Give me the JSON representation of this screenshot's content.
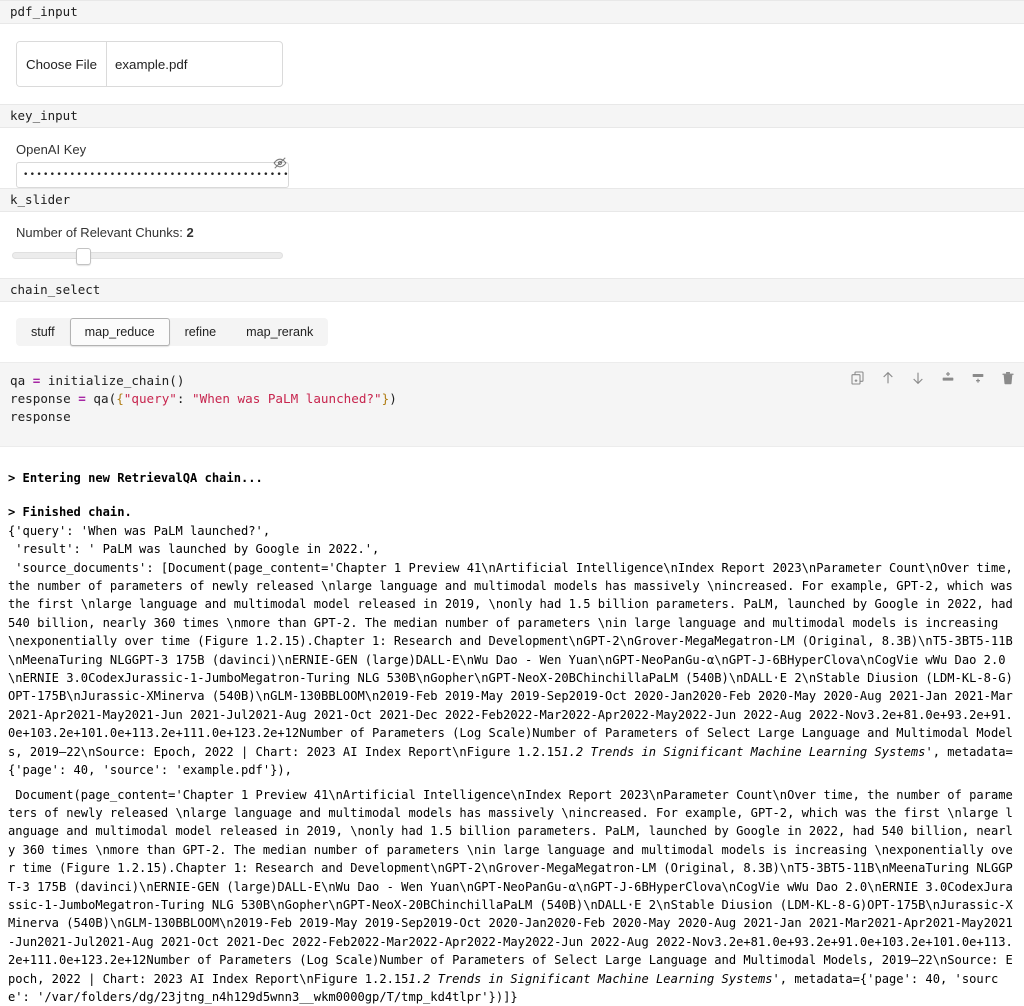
{
  "widgets": {
    "pdf_input": {
      "header": "pdf_input",
      "choose_file_label": "Choose File",
      "file_name": "example.pdf",
      "icon": "file-upload-icon"
    },
    "key_input": {
      "header": "key_input",
      "label": "OpenAI Key",
      "value": "••••••••••••••••••••••••••••••••••••••••••••••",
      "placeholder": "",
      "reveal_icon": "eye-slash-icon"
    },
    "k_slider": {
      "header": "k_slider",
      "label_prefix": "Number of Relevant Chunks: ",
      "value": "2",
      "min": 1,
      "max": 10,
      "percent": 23
    },
    "chain_select": {
      "header": "chain_select",
      "options": [
        "stuff",
        "map_reduce",
        "refine",
        "map_rerank"
      ],
      "selected": "map_reduce"
    }
  },
  "code_cell": {
    "line1_a": "qa ",
    "line1_op": "=",
    "line1_b": " initialize_chain()",
    "line2_a": "response ",
    "line2_op": "=",
    "line2_b": " qa(",
    "line2_brace_open": "{",
    "line2_key": "\"query\"",
    "line2_colon": ": ",
    "line2_val": "\"When was PaLM launched?\"",
    "line2_brace_close": "}",
    "line2_end": ")",
    "line3": "response",
    "toolbar": [
      {
        "name": "copy-cell-icon",
        "title": "Copy cell"
      },
      {
        "name": "move-cell-up-icon",
        "title": "Move cell up"
      },
      {
        "name": "move-cell-down-icon",
        "title": "Move cell down"
      },
      {
        "name": "insert-cell-above-icon",
        "title": "Insert cell above"
      },
      {
        "name": "insert-cell-below-icon",
        "title": "Insert cell below"
      },
      {
        "name": "delete-cell-icon",
        "title": "Delete cell"
      }
    ]
  },
  "output": {
    "entering_chain": "> Entering new RetrievalQA chain...",
    "finished_chain": "> Finished chain.",
    "result_head": "{'query': 'When was PaLM launched?',\n 'result': ' PaLM was launched by Google in 2022.',",
    "doc1_prefix": " 'source_documents': [Document(page_content='Chapter 1 Preview 41\\nArtificial Intelligence\\nIndex Report 2023\\nParameter Count\\nOver time, the number of parameters of newly released \\nlarge language and multimodal models has massively \\nincreased. For example, GPT-2, which was the first \\nlarge language and multimodal model released in 2019, \\nonly had 1.5 billion parameters. PaLM, launched by Google in 2022, had 540 billion, nearly 360 times \\nmore than GPT-2. The median number of parameters \\nin large language and multimodal models is increasing \\nexponentially over time (Figure 1.2.15).Chapter 1: Research and Development\\nGPT-2\\nGrover-MegaMegatron-LM (Original, 8.3B)\\nT5-3BT5-11B\\nMeenaTuring NLGGPT-3 175B (davinci)\\nERNIE-GEN (large)DALL-E\\nWu Dao - Wen Yuan\\nGPT-NeoPanGu-α\\nGPT-J-6BHyperClova\\nCogVie wWu Dao 2.0\\nERNIE 3.0CodexJurassic-1-JumboMegatron-Turing NLG 530B\\nGopher\\nGPT-NeoX-20BChinchillaPaLM (540B)\\nDALL·E 2\\nStable Diusion (LDM-KL-8-G)OPT-175B\\nJurassic-XMinerva (540B)\\nGLM-130BBLOOM\\n2019-Feb 2019-May 2019-Sep2019-Oct 2020-Jan2020-Feb 2020-May 2020-Aug 2021-Jan 2021-Mar2021-Apr2021-May2021-Jun 2021-Jul2021-Aug 2021-Oct 2021-Dec 2022-Feb2022-Mar2022-Apr2022-May2022-Jun 2022-Aug 2022-Nov3.2e+81.0e+93.2e+91.0e+103.2e+101.0e+113.2e+111.0e+123.2e+12Number of Parameters (Log Scale)Number of Parameters of Select Large Language and Multimodal Models, 2019–22\\nSource: Epoch, 2022 | Chart: 2023 AI Index Report\\nFigure 1.2.15",
    "doc1_italic": "1.2 Trends in Significant Machine Learning Systems",
    "doc1_suffix": "', metadata={'page': 40, 'source': 'example.pdf'}),",
    "doc2_prefix": " Document(page_content='Chapter 1 Preview 41\\nArtificial Intelligence\\nIndex Report 2023\\nParameter Count\\nOver time, the number of parameters of newly released \\nlarge language and multimodal models has massively \\nincreased. For example, GPT-2, which was the first \\nlarge language and multimodal model released in 2019, \\nonly had 1.5 billion parameters. PaLM, launched by Google in 2022, had 540 billion, nearly 360 times \\nmore than GPT-2. The median number of parameters \\nin large language and multimodal models is increasing \\nexponentially over time (Figure 1.2.15).Chapter 1: Research and Development\\nGPT-2\\nGrover-MegaMegatron-LM (Original, 8.3B)\\nT5-3BT5-11B\\nMeenaTuring NLGGPT-3 175B (davinci)\\nERNIE-GEN (large)DALL-E\\nWu Dao - Wen Yuan\\nGPT-NeoPanGu-α\\nGPT-J-6BHyperClova\\nCogVie wWu Dao 2.0\\nERNIE 3.0CodexJurassic-1-JumboMegatron-Turing NLG 530B\\nGopher\\nGPT-NeoX-20BChinchillaPaLM (540B)\\nDALL·E 2\\nStable Diusion (LDM-KL-8-G)OPT-175B\\nJurassic-XMinerva (540B)\\nGLM-130BBLOOM\\n2019-Feb 2019-May 2019-Sep2019-Oct 2020-Jan2020-Feb 2020-May 2020-Aug 2021-Jan 2021-Mar2021-Apr2021-May2021-Jun2021-Jul2021-Aug 2021-Oct 2021-Dec 2022-Feb2022-Mar2022-Apr2022-May2022-Jun 2022-Aug 2022-Nov3.2e+81.0e+93.2e+91.0e+103.2e+101.0e+113.2e+111.0e+123.2e+12Number of Parameters (Log Scale)Number of Parameters of Select Large Language and Multimodal Models, 2019–22\\nSource: Epoch, 2022 | Chart: 2023 AI Index Report\\nFigure 1.2.15",
    "doc2_italic": "1.2 Trends in Significant Machine Learning Systems",
    "doc2_suffix": "', metadata={'page': 40, 'source': '/var/folders/dg/23jtng_n4h129d5wnn3__wkm0000gp/T/tmp_kd4tlpr'})]}"
  },
  "colors": {
    "section_header_bg": "#f5f5f5",
    "code_cell_bg": "#f5f5f5",
    "string_token": "#c7254e",
    "operator_token": "#a626a4",
    "brace_token": "#b07d15",
    "toolbar_icon": "#8a8a8a"
  }
}
